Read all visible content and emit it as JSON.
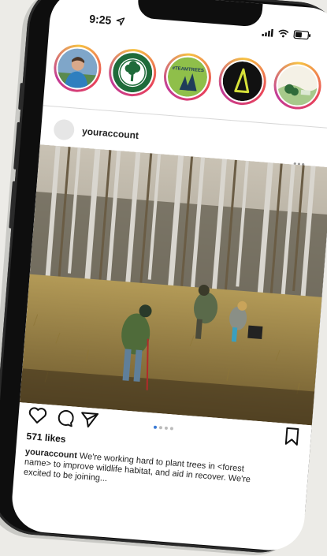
{
  "status_bar": {
    "time": "9:25"
  },
  "stories": [
    {
      "name": "person-story"
    },
    {
      "name": "tree-badge-story"
    },
    {
      "name": "teamtrees-story",
      "text": "#TEAMTREES"
    },
    {
      "name": "triangle-logo-story"
    },
    {
      "name": "landscape-story"
    }
  ],
  "post": {
    "username": "youraccount",
    "more": "•••",
    "likes": "571 likes",
    "caption_user": "youraccount",
    "caption_text": " We're working hard to plant trees in <forest name> to improve wildlife habitat, and aid in recover. We're excited to be joining..."
  },
  "colors": {
    "story_gradient": [
      "#f6c344",
      "#e8425a",
      "#c23a96"
    ],
    "carousel_active": "#3a7bd5",
    "background": "#ecebe7"
  },
  "icons": [
    "heart-icon",
    "comment-icon",
    "share-icon",
    "bookmark-icon",
    "signal-icon",
    "wifi-icon",
    "battery-icon",
    "location-arrow-icon"
  ]
}
